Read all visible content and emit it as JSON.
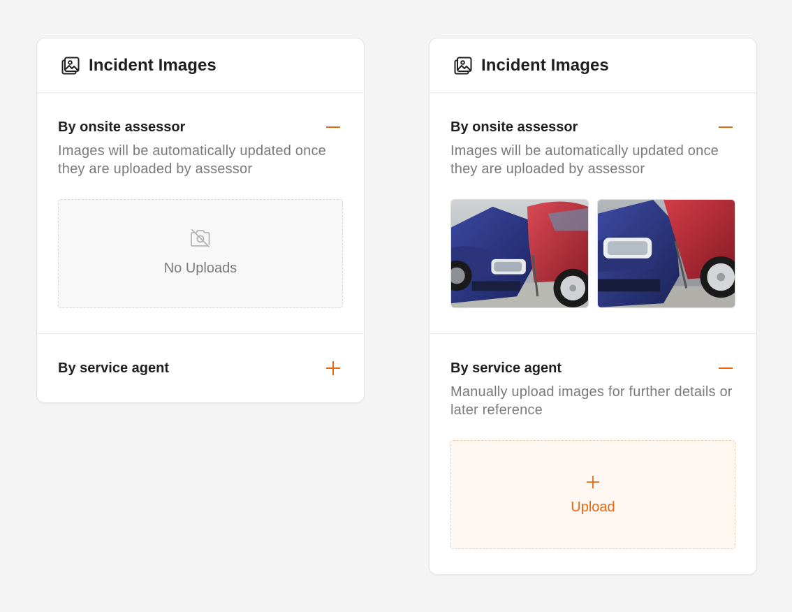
{
  "colors": {
    "accent": "#e8670f",
    "muted_text": "#7a7a7a",
    "heading_text": "#1f1f1f",
    "card_border": "#e3e3e3"
  },
  "cards": [
    {
      "header": {
        "title": "Incident Images",
        "icon": "images-icon"
      },
      "onsite": {
        "title": "By onsite assessor",
        "toggle": "minus-icon",
        "description": "Images will be automatically updated once they are uploaded by assessor",
        "empty_label": "No Uploads",
        "empty_icon": "no-camera-icon"
      },
      "service": {
        "title": "By service agent",
        "toggle": "plus-icon"
      }
    },
    {
      "header": {
        "title": "Incident Images",
        "icon": "images-icon"
      },
      "onsite": {
        "title": "By onsite assessor",
        "toggle": "minus-icon",
        "description": "Images will be automatically updated once they are uploaded by assessor",
        "photos": [
          "car-collision-photo",
          "car-collision-photo"
        ]
      },
      "service": {
        "title": "By service agent",
        "toggle": "minus-icon",
        "description": "Manually upload images for further details or later reference",
        "upload_label": "Upload"
      }
    }
  ]
}
